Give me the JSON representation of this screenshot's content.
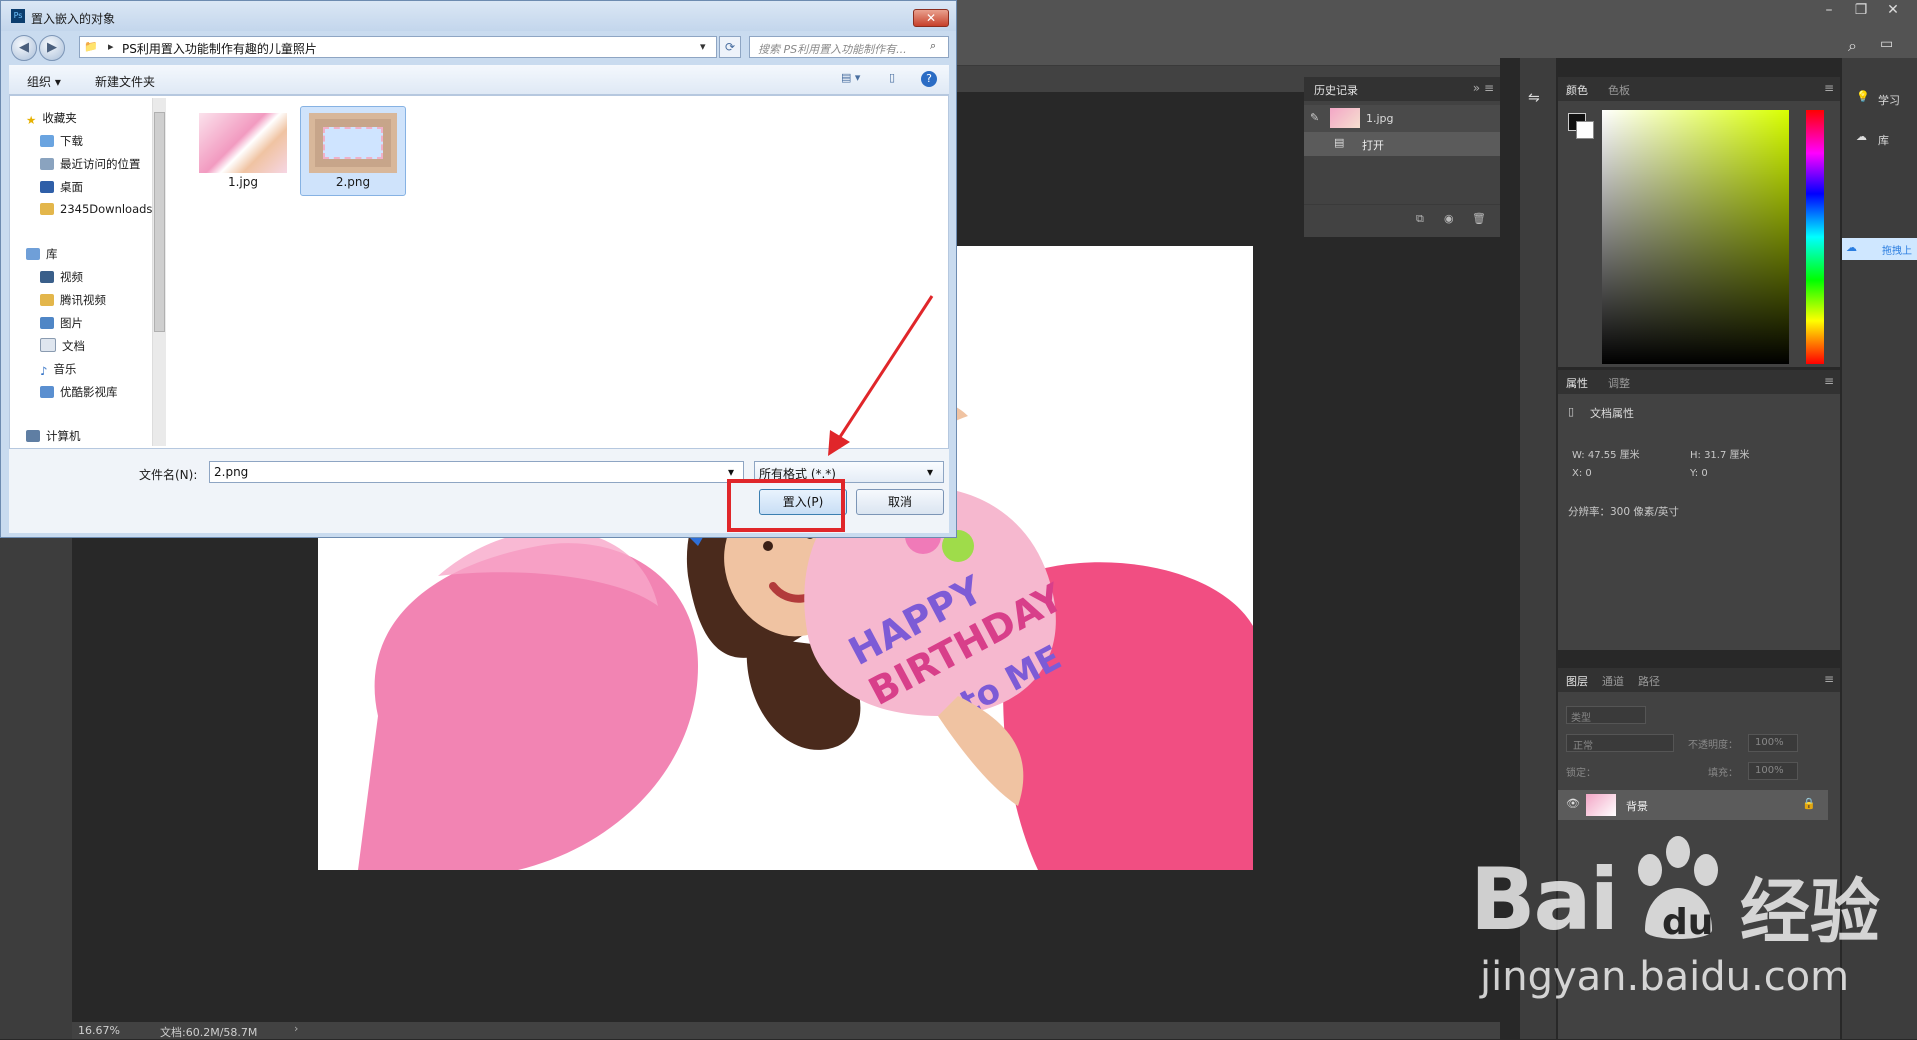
{
  "photoshop": {
    "status_zoom": "16.67%",
    "status_doc": "文档:60.2M/58.7M",
    "history": {
      "tab_label": "历史记录",
      "rows": [
        {
          "label": "1.jpg"
        },
        {
          "label": "打开"
        }
      ]
    },
    "color": {
      "tabs": [
        "颜色",
        "色板"
      ]
    },
    "properties": {
      "tabs": [
        "属性",
        "调整"
      ],
      "doc_props": "文档属性",
      "w": "W:  47.55 厘米",
      "h": "H:  31.7 厘米",
      "x": "X:  0",
      "y": "Y:  0",
      "resolution": "分辨率：300 像素/英寸"
    },
    "layers": {
      "tabs": [
        "图层",
        "通道",
        "路径"
      ],
      "filter_kind": "类型",
      "blend_mode": "正常",
      "opacity_label": "不透明度：",
      "opacity_value": "100%",
      "lock_label": "锁定：",
      "fill_label": "填充：",
      "fill_value": "100%",
      "layer_name": "背景"
    },
    "learn": {
      "learn_label": "学习",
      "library_label": "库",
      "side_button": "拖拽上"
    }
  },
  "dialog": {
    "title": "置入嵌入的对象",
    "close_label": "✕",
    "address_path": "PS利用置入功能制作有趣的儿童照片",
    "search_placeholder": "搜索 PS利用置入功能制作有...",
    "toolbar": {
      "organize": "组织 ▾",
      "new_folder": "新建文件夹"
    },
    "nav": {
      "favorites_header": "收藏夹",
      "favorites": [
        "下载",
        "最近访问的位置",
        "桌面",
        "2345Downloads"
      ],
      "library_header": "库",
      "libraries": [
        "视频",
        "腾讯视频",
        "图片",
        "文档",
        "音乐",
        "优酷影视库"
      ],
      "computer": "计算机"
    },
    "files": [
      {
        "name": "1.jpg",
        "selected": false
      },
      {
        "name": "2.png",
        "selected": true
      }
    ],
    "filename_label": "文件名(N):",
    "filename_value": "2.png",
    "filetype_value": "所有格式 (*.*)",
    "place_button": "置入(P)",
    "cancel_button": "取消"
  },
  "watermark": {
    "brand_left": "Bai",
    "brand_right": "经验",
    "url": "jingyan.baidu.com"
  },
  "colors": {
    "highlight": "#e0262a",
    "arrow": "#e0262a"
  }
}
